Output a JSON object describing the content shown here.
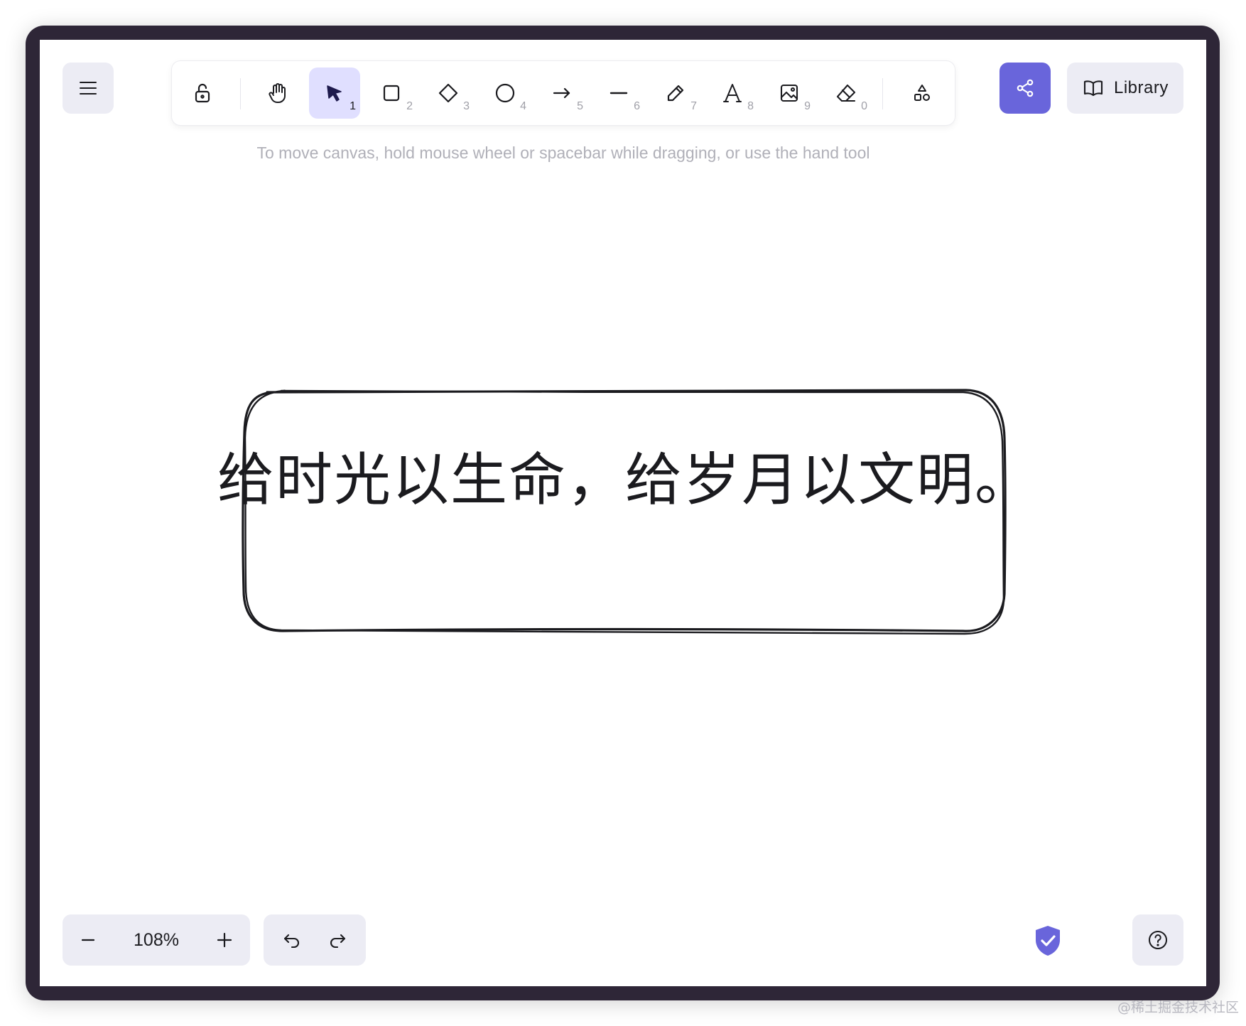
{
  "toolbar": {
    "tools": [
      {
        "name": "lock",
        "icon": "lock-open-icon",
        "key": ""
      },
      {
        "name": "hand",
        "icon": "hand-icon",
        "key": ""
      },
      {
        "name": "selection",
        "icon": "pointer-icon",
        "key": "1",
        "active": true
      },
      {
        "name": "rectangle",
        "icon": "rectangle-icon",
        "key": "2"
      },
      {
        "name": "diamond",
        "icon": "diamond-icon",
        "key": "3"
      },
      {
        "name": "ellipse",
        "icon": "circle-icon",
        "key": "4"
      },
      {
        "name": "arrow",
        "icon": "arrow-right-icon",
        "key": "5"
      },
      {
        "name": "line",
        "icon": "line-icon",
        "key": "6"
      },
      {
        "name": "draw",
        "icon": "pencil-icon",
        "key": "7"
      },
      {
        "name": "text",
        "icon": "text-icon",
        "key": "8"
      },
      {
        "name": "image",
        "icon": "image-icon",
        "key": "9"
      },
      {
        "name": "eraser",
        "icon": "eraser-icon",
        "key": "0"
      },
      {
        "name": "more-tools",
        "icon": "shapes-icon",
        "key": ""
      }
    ],
    "active_color": "#e0dfff"
  },
  "hint": "To move canvas, hold mouse wheel or spacebar while dragging, or use the hand tool",
  "share": {
    "icon": "share-icon",
    "color": "#6965db"
  },
  "library": {
    "label": "Library",
    "icon": "book-icon"
  },
  "canvas": {
    "text": "给时光以生命，给岁月以文明。"
  },
  "zoom": {
    "value": "108%",
    "minus_icon": "minus-icon",
    "plus_icon": "plus-icon"
  },
  "history": {
    "undo_icon": "undo-icon",
    "redo_icon": "redo-icon"
  },
  "shield": {
    "icon": "shield-check-icon",
    "color": "#6965db"
  },
  "help": {
    "icon": "help-circle-icon"
  },
  "watermark": "@稀土掘金技术社区",
  "colors": {
    "frame": "#2e2637",
    "soft_button": "#ececf4",
    "stroke": "#1b1b1f"
  }
}
